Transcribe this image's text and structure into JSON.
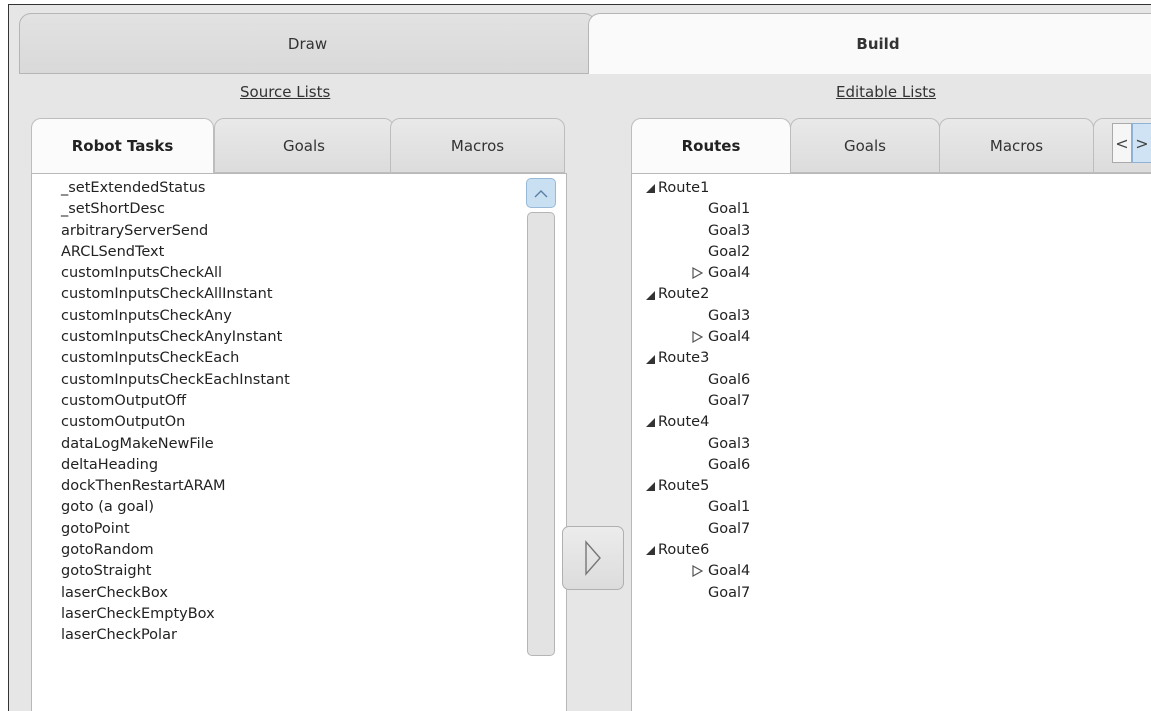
{
  "top_tabs": {
    "draw": "Draw",
    "build": "Build"
  },
  "source_lists_label": "Source Lists",
  "editable_lists_label": "Editable Lists",
  "left_tabs": [
    "Robot Tasks",
    "Goals",
    "Macros"
  ],
  "right_tabs": [
    "Routes",
    "Goals",
    "Macros"
  ],
  "tab_scroll": {
    "left": "<",
    "right": ">"
  },
  "robot_tasks": [
    "_setExtendedStatus",
    "_setShortDesc",
    "arbitraryServerSend",
    "ARCLSendText",
    "customInputsCheckAll",
    "customInputsCheckAllInstant",
    "customInputsCheckAny",
    "customInputsCheckAnyInstant",
    "customInputsCheckEach",
    "customInputsCheckEachInstant",
    "customOutputOff",
    "customOutputOn",
    "dataLogMakeNewFile",
    "deltaHeading",
    "dockThenRestartARAM",
    "goto (a goal)",
    "gotoPoint",
    "gotoRandom",
    "gotoStraight",
    "laserCheckBox",
    "laserCheckEmptyBox",
    "laserCheckPolar"
  ],
  "routes": [
    {
      "name": "Route1",
      "goals": [
        {
          "name": "Goal1",
          "expandable": false
        },
        {
          "name": "Goal3",
          "expandable": false
        },
        {
          "name": "Goal2",
          "expandable": false
        },
        {
          "name": "Goal4",
          "expandable": true
        }
      ]
    },
    {
      "name": "Route2",
      "goals": [
        {
          "name": "Goal3",
          "expandable": false
        },
        {
          "name": "Goal4",
          "expandable": true
        }
      ]
    },
    {
      "name": "Route3",
      "goals": [
        {
          "name": "Goal6",
          "expandable": false
        },
        {
          "name": "Goal7",
          "expandable": false
        }
      ]
    },
    {
      "name": "Route4",
      "goals": [
        {
          "name": "Goal3",
          "expandable": false
        },
        {
          "name": "Goal6",
          "expandable": false
        }
      ]
    },
    {
      "name": "Route5",
      "goals": [
        {
          "name": "Goal1",
          "expandable": false
        },
        {
          "name": "Goal7",
          "expandable": false
        }
      ]
    },
    {
      "name": "Route6",
      "goals": [
        {
          "name": "Goal4",
          "expandable": true
        },
        {
          "name": "Goal7",
          "expandable": false
        }
      ]
    }
  ]
}
